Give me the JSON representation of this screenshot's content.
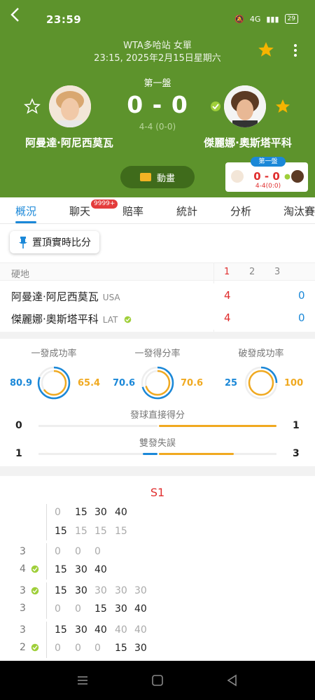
{
  "status_bar": {
    "time": "23:59",
    "battery": "29",
    "network": "4G"
  },
  "header": {
    "title": "WTA多哈站 女單",
    "datetime": "23:15, 2025年2月15日星期六",
    "set_label": "第一盤",
    "score": "0 - 0",
    "games": "4-4 (0-0)",
    "player1": {
      "name": "阿曼達·阿尼西莫瓦"
    },
    "player2": {
      "name": "傑麗娜·奧斯塔平科"
    },
    "animation_label": "動畫",
    "mini_card": {
      "tag": "第一盤",
      "score": "0 - 0",
      "games": "4-4(0:0)"
    }
  },
  "tabs": [
    {
      "label": "概況"
    },
    {
      "label": "聊天"
    },
    {
      "label": "賠率"
    },
    {
      "label": "統計"
    },
    {
      "label": "分析"
    },
    {
      "label": "淘汰賽"
    }
  ],
  "chat_badge": "9999+",
  "pin_button": "置頂實時比分",
  "scoreboard": {
    "surface": "硬地",
    "set_cols": [
      "1",
      "2",
      "3"
    ],
    "rows": [
      {
        "name": "阿曼達·阿尼西莫瓦",
        "country": "USA",
        "s1": "4",
        "s2": "0"
      },
      {
        "name": "傑麗娜·奧斯塔平科",
        "country": "LAT",
        "s1": "4",
        "s2": "0"
      }
    ]
  },
  "stats": {
    "circles": [
      {
        "title": "一發成功率",
        "left": "80.9",
        "right": "65.4"
      },
      {
        "title": "一發得分率",
        "left": "70.6",
        "right": "70.6"
      },
      {
        "title": "破發成功率",
        "left": "25",
        "right": "100"
      }
    ],
    "bars": [
      {
        "title": "發球直接得分",
        "left": "0",
        "right": "1",
        "left_value": 0,
        "right_value": 1
      },
      {
        "title": "雙發失誤",
        "left": "1",
        "right": "3",
        "left_value": 1,
        "right_value": 3
      }
    ]
  },
  "pbp": {
    "set_title": "S1",
    "games": [
      {
        "server_row": [
          "0",
          "15",
          "30",
          "40"
        ],
        "receiver_row": [
          "15",
          "15",
          "15",
          "15"
        ]
      },
      {
        "score_a": "3",
        "score_b": "4",
        "row_a": [
          "0",
          "0",
          "0"
        ],
        "row_b": [
          "15",
          "30",
          "40"
        ]
      },
      {
        "score_a": "3",
        "score_b": "3",
        "row_a": [
          "15",
          "30",
          "30",
          "30",
          "30"
        ],
        "row_b": [
          "0",
          "0",
          "15",
          "30",
          "40"
        ]
      },
      {
        "score_a": "3",
        "score_b": "2",
        "row_a": [
          "15",
          "30",
          "40",
          "40",
          "40"
        ],
        "row_b": [
          "0",
          "0",
          "0",
          "15",
          "30"
        ]
      }
    ]
  },
  "colors": {
    "header_green": "#5d932c",
    "accent_blue": "#1b88d8",
    "accent_red": "#e02e2e",
    "accent_yellow": "#f0a920"
  }
}
